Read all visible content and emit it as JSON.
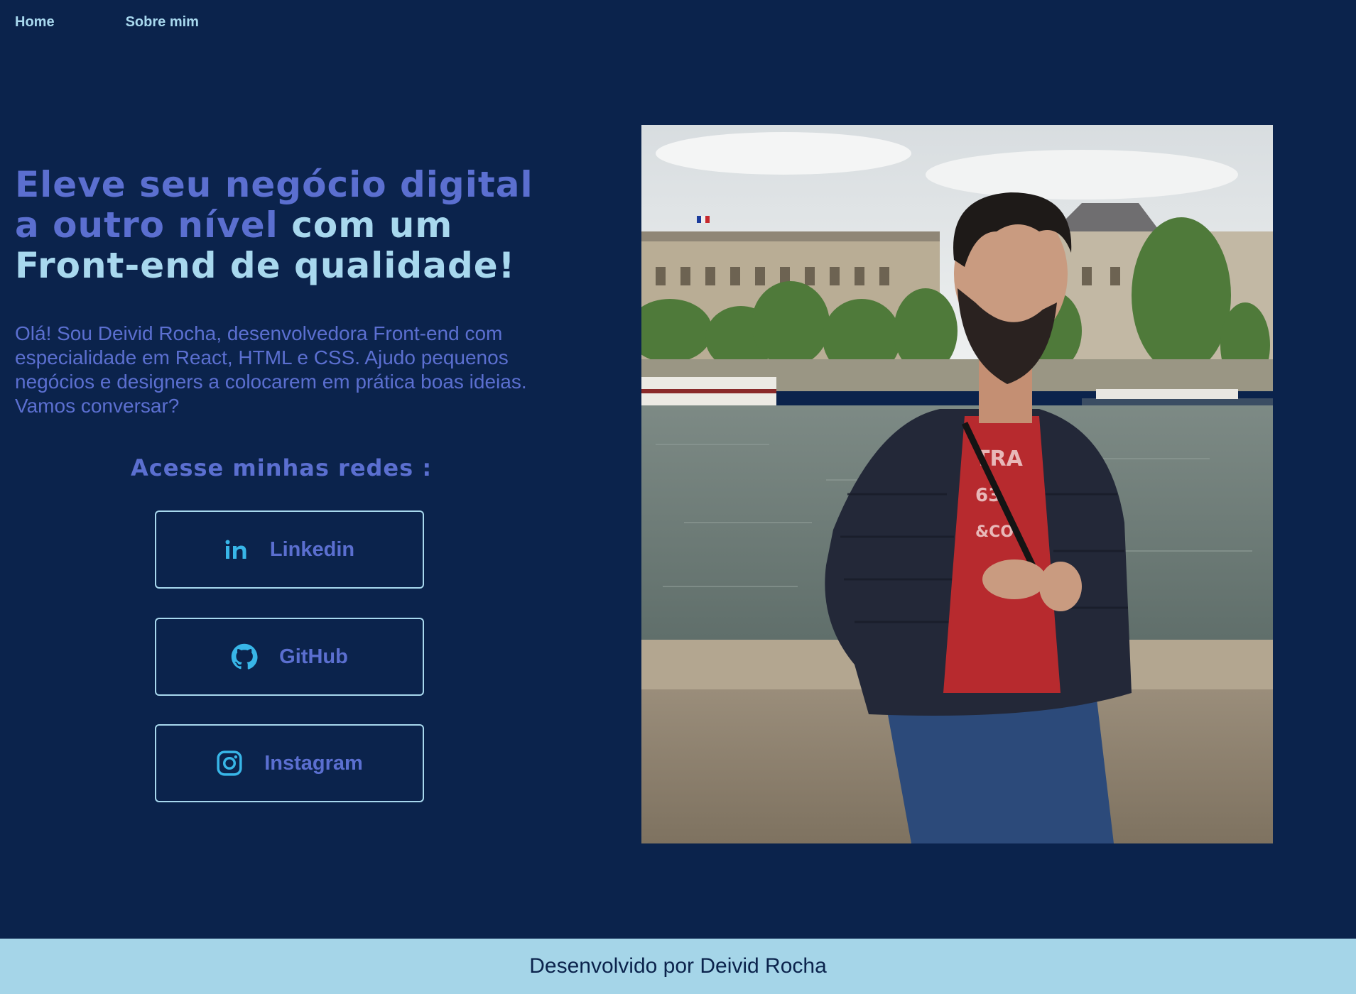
{
  "nav": {
    "home": "Home",
    "about": "Sobre mim"
  },
  "hero": {
    "headline_part1": "Eleve seu negócio digital",
    "headline_part2": "a outro nível",
    "headline_part3": "com um",
    "headline_part4": "Front-end de qualidade!",
    "intro": "Olá! Sou Deivid Rocha, desenvolvedora Front-end com especialidade em React, HTML e CSS. Ajudo pequenos negócios e designers a colocarem em prática boas ideias. Vamos conversar?"
  },
  "social": {
    "title": "Acesse minhas redes :",
    "buttons": [
      {
        "label": "Linkedin",
        "icon": "linkedin-icon"
      },
      {
        "label": "GitHub",
        "icon": "github-icon"
      },
      {
        "label": "Instagram",
        "icon": "instagram-icon"
      }
    ]
  },
  "footer": {
    "text": "Desenvolvido por Deivid Rocha"
  },
  "colors": {
    "background": "#0b234c",
    "accent": "#5b6fd0",
    "light": "#a8d8ee",
    "footer_bg": "#a5d5e8"
  }
}
